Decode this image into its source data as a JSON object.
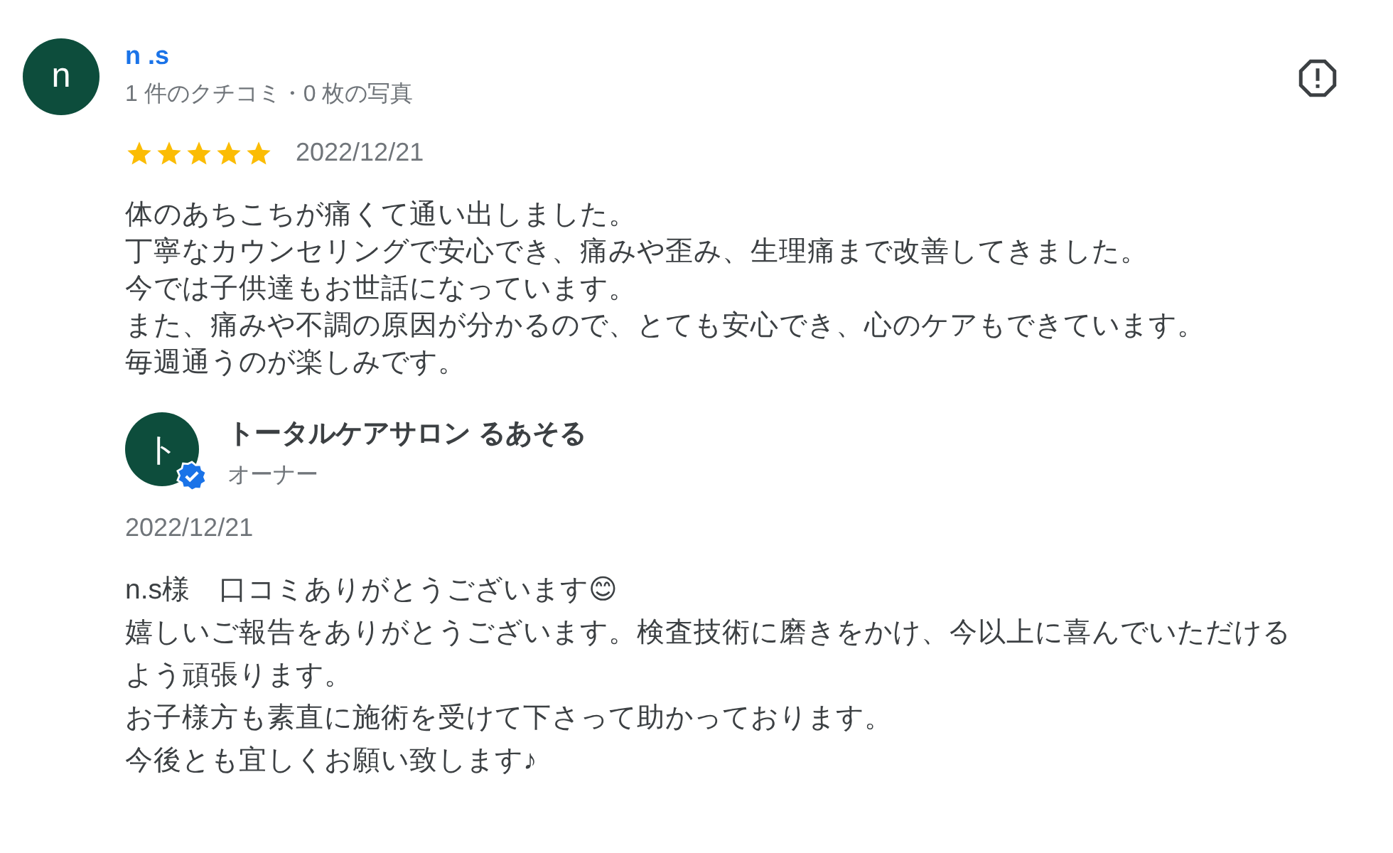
{
  "review": {
    "author": {
      "initial": "n",
      "name": "n .s",
      "meta": "1 件のクチコミ・0 枚の写真"
    },
    "stars": 5,
    "date": "2022/12/21",
    "text": [
      "体のあちこちが痛くて通い出しました。",
      "丁寧なカウンセリングで安心でき、痛みや歪み、生理痛まで改善してきました。",
      "今では子供達もお世話になっています。",
      "また、痛みや不調の原因が分かるので、とても安心でき、心のケアもできています。",
      "毎週通うのが楽しみです。"
    ]
  },
  "reply": {
    "author": {
      "initial": "ト",
      "name": "トータルケアサロン るあそる",
      "role": "オーナー",
      "verified": true
    },
    "date": "2022/12/21",
    "text": [
      "n.s様　口コミありがとうございます😊",
      "嬉しいご報告をありがとうございます。検査技術に磨きをかけ、今以上に喜んでいただけるよう頑張ります。",
      "お子様方も素直に施術を受けて下さって助かっております。",
      "今後とも宜しくお願い致します♪"
    ]
  }
}
